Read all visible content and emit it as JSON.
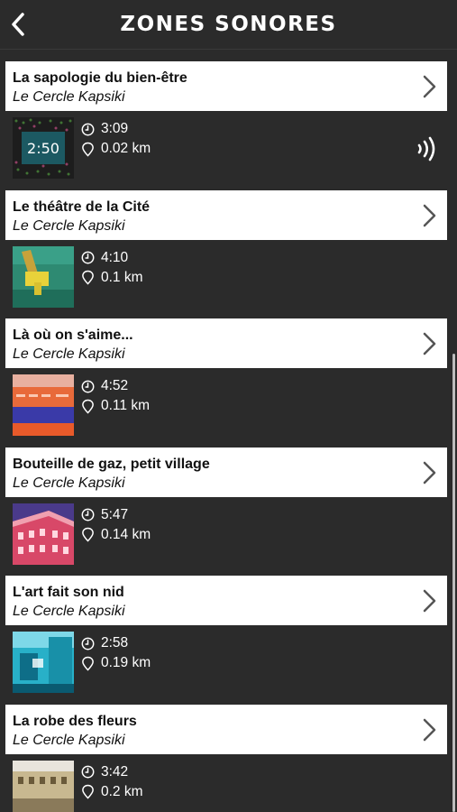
{
  "header": {
    "title": "ZONES SONORES",
    "back_icon": "chevron-left-icon"
  },
  "colors": {
    "background": "#2b2b2b",
    "card": "#ffffff",
    "text_dark": "#111111",
    "text_light": "#ffffff"
  },
  "items": [
    {
      "title": "La sapologie du bien-être",
      "author": "Le Cercle Kapsiki",
      "duration": "3:09",
      "distance": "0.02 km",
      "overlay": "2:50",
      "playing": true
    },
    {
      "title": "Le théâtre de la Cité",
      "author": "Le Cercle Kapsiki",
      "duration": "4:10",
      "distance": "0.1 km"
    },
    {
      "title": "Là où on s'aime...",
      "author": "Le Cercle Kapsiki",
      "duration": "4:52",
      "distance": "0.11 km"
    },
    {
      "title": "Bouteille de gaz, petit village",
      "author": "Le Cercle Kapsiki",
      "duration": "5:47",
      "distance": "0.14 km"
    },
    {
      "title": "L'art fait son nid",
      "author": "Le Cercle Kapsiki",
      "duration": "2:58",
      "distance": "0.19 km"
    },
    {
      "title": "La robe des fleurs",
      "author": "Le Cercle Kapsiki",
      "duration": "3:42",
      "distance": "0.2 km"
    }
  ]
}
